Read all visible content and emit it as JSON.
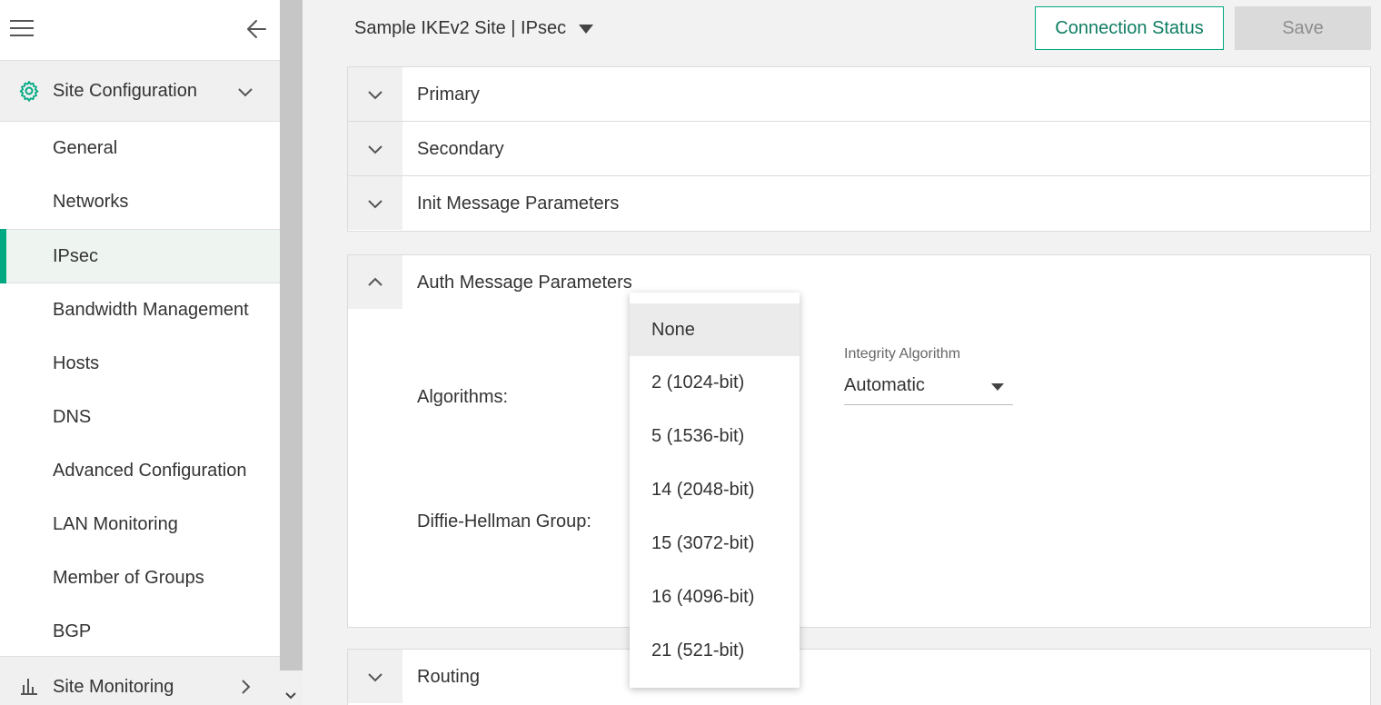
{
  "sidebar": {
    "section_title": "Site Configuration",
    "items": [
      {
        "label": "General"
      },
      {
        "label": "Networks"
      },
      {
        "label": "IPsec"
      },
      {
        "label": "Bandwidth Management"
      },
      {
        "label": "Hosts"
      },
      {
        "label": "DNS"
      },
      {
        "label": "Advanced Configuration"
      },
      {
        "label": "LAN Monitoring"
      },
      {
        "label": "Member of Groups"
      },
      {
        "label": "BGP"
      }
    ],
    "monitoring_title": "Site Monitoring"
  },
  "header": {
    "site_title": "Sample IKEv2 Site | IPsec",
    "connection_status_label": "Connection Status",
    "save_label": "Save"
  },
  "accordion": {
    "primary": "Primary",
    "secondary": "Secondary",
    "init": "Init Message Parameters",
    "auth": "Auth Message Parameters",
    "routing": "Routing"
  },
  "auth": {
    "algorithms_label": "Algorithms:",
    "dh_label": "Diffie-Hellman Group:",
    "integrity_label": "Integrity Algorithm",
    "integrity_value": "Automatic"
  },
  "dh_dropdown": {
    "options": [
      "None",
      "2 (1024-bit)",
      "5 (1536-bit)",
      "14 (2048-bit)",
      "15 (3072-bit)",
      "16 (4096-bit)",
      "21 (521-bit)"
    ]
  },
  "colors": {
    "accent": "#01a982",
    "accent_text": "#0f7d63"
  }
}
